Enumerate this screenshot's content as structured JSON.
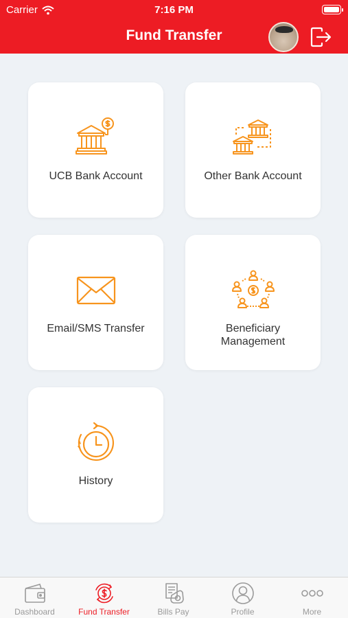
{
  "status_bar": {
    "carrier": "Carrier",
    "time": "7:16 PM"
  },
  "header": {
    "title": "Fund Transfer",
    "avatar_icon": "user-avatar",
    "logout_icon": "logout-icon"
  },
  "menu": [
    {
      "label": "UCB Bank Account",
      "icon": "bank-dollar-icon"
    },
    {
      "label": "Other Bank Account",
      "icon": "bank-transfer-icon"
    },
    {
      "label": "Email/SMS Transfer",
      "icon": "envelope-icon"
    },
    {
      "label": "Beneficiary\nManagement",
      "icon": "beneficiary-network-icon"
    },
    {
      "label": "History",
      "icon": "history-clock-icon"
    }
  ],
  "tabs": [
    {
      "label": "Dashboard",
      "icon": "wallet-icon",
      "active": false
    },
    {
      "label": "Fund Transfer",
      "icon": "transfer-dollar-icon",
      "active": true
    },
    {
      "label": "Bills Pay",
      "icon": "bills-pay-icon",
      "active": false
    },
    {
      "label": "Profile",
      "icon": "profile-icon",
      "active": false
    },
    {
      "label": "More",
      "icon": "more-dots-icon",
      "active": false
    }
  ],
  "colors": {
    "brand": "#ed1c24",
    "icon_accent": "#f7941d",
    "tab_inactive": "#9a9a9a"
  }
}
